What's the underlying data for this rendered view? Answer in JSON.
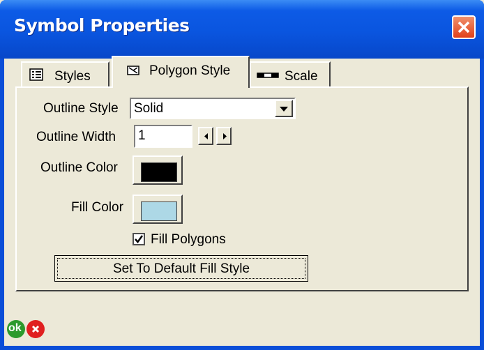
{
  "window": {
    "title": "Symbol Properties"
  },
  "tabs": [
    {
      "label": "Styles",
      "icon": "list-icon",
      "active": false
    },
    {
      "label": "Polygon Style",
      "icon": "polygon-icon",
      "active": true
    },
    {
      "label": "Scale",
      "icon": "scale-bar-icon",
      "active": false
    }
  ],
  "outline_style": {
    "label": "Outline Style",
    "value": "Solid"
  },
  "outline_width": {
    "label": "Outline Width",
    "value": "1"
  },
  "outline_color": {
    "label": "Outline Color",
    "color": "#000000"
  },
  "fill_color": {
    "label": "Fill Color",
    "color": "#add8e6"
  },
  "fill_polygons": {
    "label": "Fill Polygons",
    "checked": true
  },
  "default_button": {
    "label": "Set To Default Fill Style"
  },
  "footer": {
    "ok_label": "ok"
  },
  "colors": {
    "titlebar": "#0a55df",
    "face": "#ece9d8",
    "close": "#e0401a",
    "ok": "#2c9a2c",
    "cancel": "#e02020"
  }
}
